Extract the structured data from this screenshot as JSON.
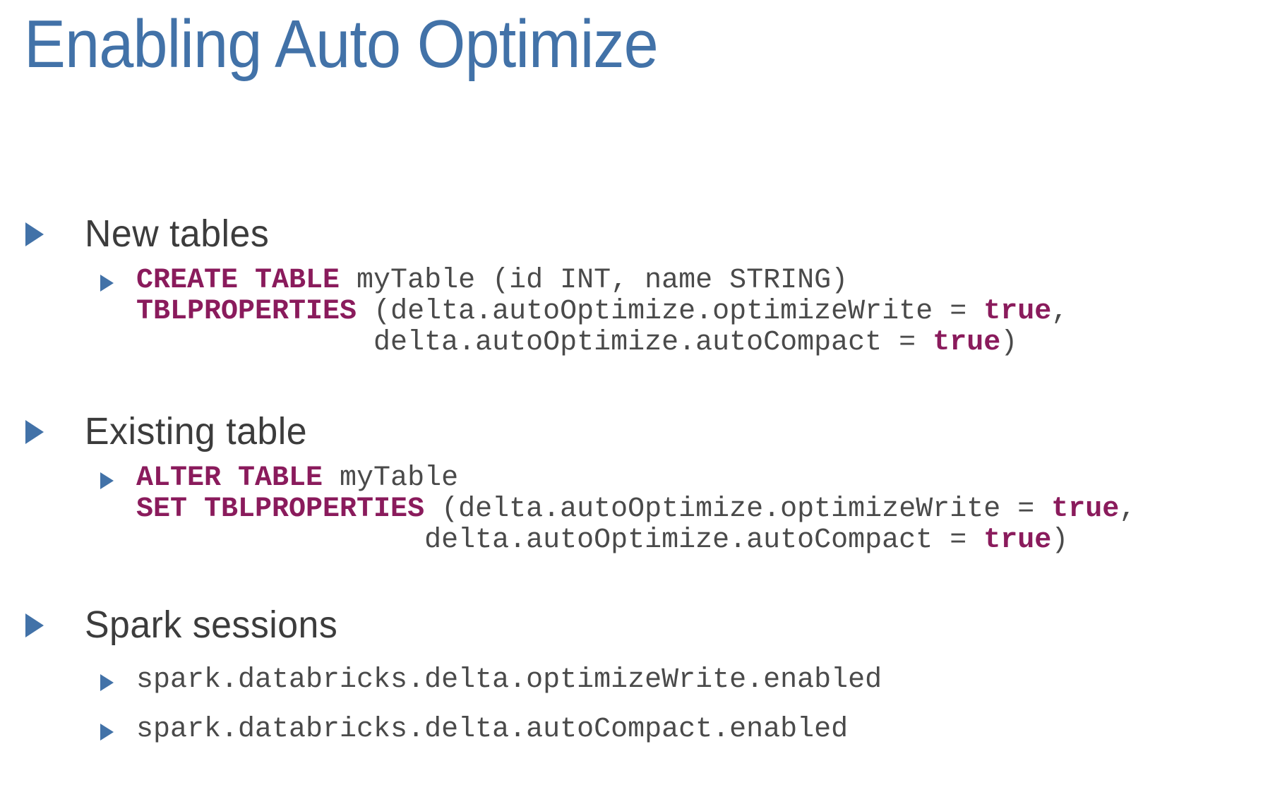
{
  "slide": {
    "title": "Enabling Auto Optimize",
    "colors": {
      "title": "#4272a8",
      "bullet": "#4272a8",
      "body_text": "#3c3c3c",
      "code_text": "#4a4a4a",
      "keyword": "#8a1b5c",
      "background": "#ffffff"
    },
    "sections": [
      {
        "heading": "New tables",
        "code_lines": [
          [
            {
              "t": "CREATE TABLE",
              "k": true
            },
            {
              "t": " myTable (id INT, name STRING)",
              "k": false
            }
          ],
          [
            {
              "t": "TBLPROPERTIES",
              "k": true
            },
            {
              "t": " (delta.autoOptimize.optimizeWrite = ",
              "k": false
            },
            {
              "t": "true",
              "k": true
            },
            {
              "t": ",",
              "k": false
            }
          ],
          [
            {
              "t": "              delta.autoOptimize.autoCompact = ",
              "k": false
            },
            {
              "t": "true",
              "k": true
            },
            {
              "t": ")",
              "k": false
            }
          ]
        ]
      },
      {
        "heading": "Existing table",
        "code_lines": [
          [
            {
              "t": "ALTER TABLE",
              "k": true
            },
            {
              "t": " myTable",
              "k": false
            }
          ],
          [
            {
              "t": "SET TBLPROPERTIES",
              "k": true
            },
            {
              "t": " (delta.autoOptimize.optimizeWrite = ",
              "k": false
            },
            {
              "t": "true",
              "k": true
            },
            {
              "t": ",",
              "k": false
            }
          ],
          [
            {
              "t": "                 delta.autoOptimize.autoCompact = ",
              "k": false
            },
            {
              "t": "true",
              "k": true
            },
            {
              "t": ")",
              "k": false
            }
          ]
        ]
      },
      {
        "heading": "Spark sessions",
        "sub_items": [
          "spark.databricks.delta.optimizeWrite.enabled",
          "spark.databricks.delta.autoCompact.enabled"
        ]
      }
    ]
  }
}
